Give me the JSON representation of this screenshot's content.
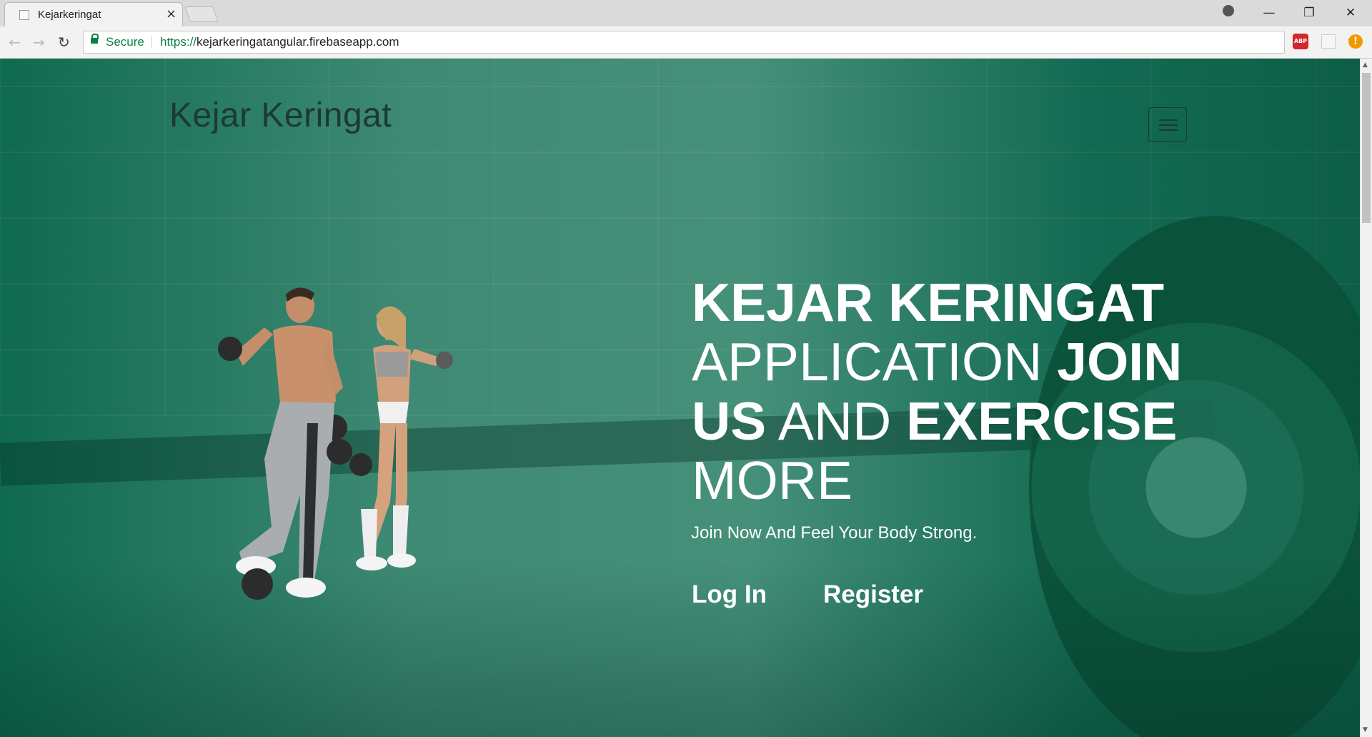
{
  "browser": {
    "tab_title": "Kejarkeringat",
    "tab_close": "×",
    "security_label": "Secure",
    "url_scheme": "https://",
    "url_rest": "kejarkeringatangular.firebaseapp.com",
    "abp_label": "ABP",
    "alert_label": "!",
    "window_controls": {
      "minimize": "—",
      "restore": "❐",
      "close": "✕"
    },
    "nav": {
      "back": "←",
      "forward": "→",
      "reload": "↻"
    },
    "bookmark": "☆"
  },
  "site": {
    "brand": "Kejar Keringat",
    "headline": {
      "line1_bold": "KEJAR KERINGAT",
      "line2_light": "APPLICATION ",
      "line2_bold": "JOIN",
      "line3_bold": "US",
      "line3_light": " AND ",
      "line3_bold2": "EXERCISE",
      "line4_light": "MORE"
    },
    "subtitle": "Join Now And Feel Your Body Strong.",
    "login_label": "Log In",
    "register_label": "Register"
  },
  "colors": {
    "theme_green": "#2f7a63",
    "dark_green": "#0d5e47",
    "brand_text": "#1d3a32",
    "secure_green": "#0b8043"
  },
  "icons": [
    "favicon-icon",
    "close-icon",
    "new-tab-icon",
    "profile-icon",
    "back-icon",
    "forward-icon",
    "reload-icon",
    "lock-icon",
    "star-icon",
    "adblock-icon",
    "extension-icon",
    "alert-icon",
    "hamburger-menu-icon"
  ]
}
